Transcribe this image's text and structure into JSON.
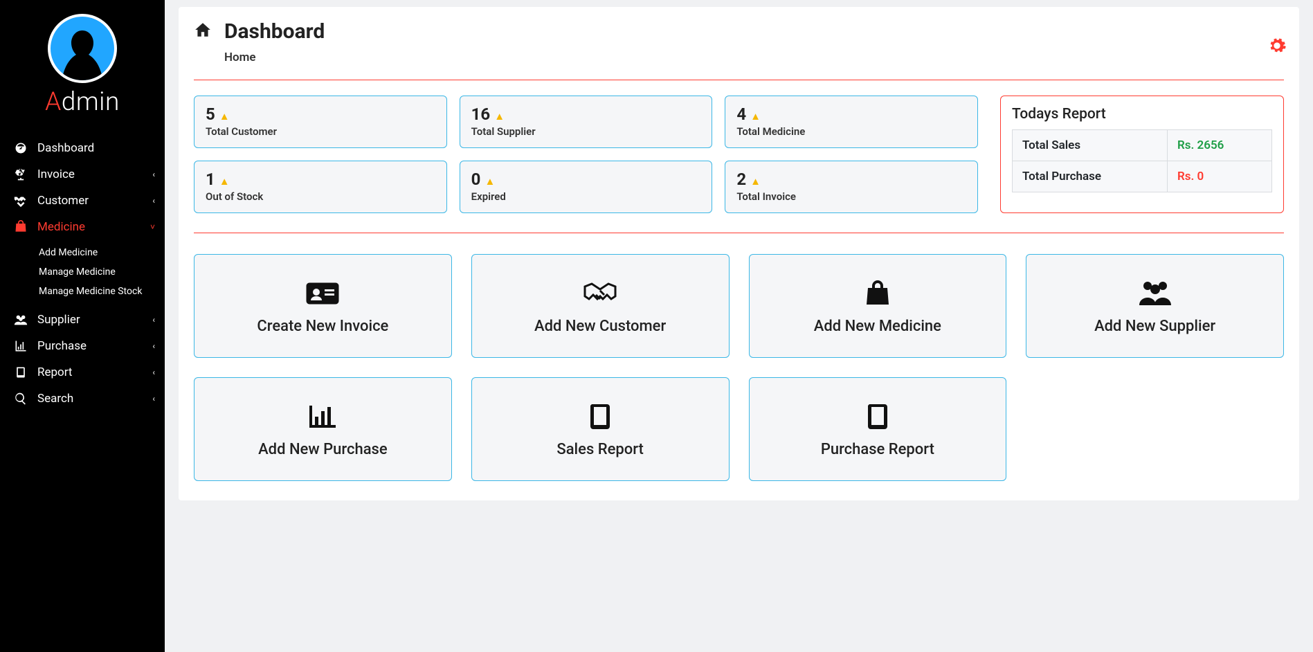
{
  "sidebar": {
    "admin_label_first": "A",
    "admin_label_rest": "dmin",
    "items": [
      {
        "label": "Dashboard",
        "has_children": false,
        "active": false
      },
      {
        "label": "Invoice",
        "has_children": true,
        "active": false
      },
      {
        "label": "Customer",
        "has_children": true,
        "active": false
      },
      {
        "label": "Medicine",
        "has_children": true,
        "active": true,
        "children": [
          "Add Medicine",
          "Manage Medicine",
          "Manage Medicine Stock"
        ]
      },
      {
        "label": "Supplier",
        "has_children": true,
        "active": false
      },
      {
        "label": "Purchase",
        "has_children": true,
        "active": false
      },
      {
        "label": "Report",
        "has_children": true,
        "active": false
      },
      {
        "label": "Search",
        "has_children": true,
        "active": false
      }
    ]
  },
  "header": {
    "title": "Dashboard",
    "breadcrumb": "Home"
  },
  "stats": [
    {
      "value": "5",
      "label": "Total Customer"
    },
    {
      "value": "16",
      "label": "Total Supplier"
    },
    {
      "value": "4",
      "label": "Total Medicine"
    },
    {
      "value": "1",
      "label": "Out of Stock"
    },
    {
      "value": "0",
      "label": "Expired"
    },
    {
      "value": "2",
      "label": "Total Invoice"
    }
  ],
  "todays_report": {
    "title": "Todays Report",
    "rows": [
      {
        "label": "Total Sales",
        "value": "Rs. 2656",
        "color": "green"
      },
      {
        "label": "Total Purchase",
        "value": "Rs. 0",
        "color": "red"
      }
    ]
  },
  "actions_row1": [
    {
      "label": "Create New Invoice",
      "icon": "id-card"
    },
    {
      "label": "Add New Customer",
      "icon": "handshake"
    },
    {
      "label": "Add New Medicine",
      "icon": "bag"
    },
    {
      "label": "Add New Supplier",
      "icon": "users"
    }
  ],
  "actions_row2": [
    {
      "label": "Add New Purchase",
      "icon": "chart"
    },
    {
      "label": "Sales Report",
      "icon": "book"
    },
    {
      "label": "Purchase Report",
      "icon": "book"
    }
  ]
}
